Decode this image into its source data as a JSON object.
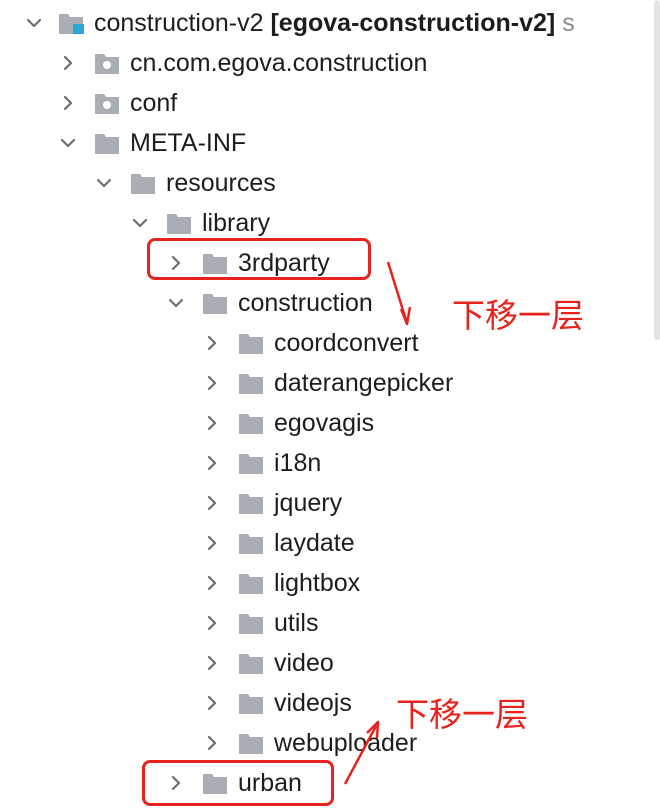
{
  "project": {
    "name": "construction-v2",
    "module_label": "[egova-construction-v2]",
    "trailing": "s"
  },
  "tree": {
    "packages": [
      "cn.com.egova.construction",
      "conf"
    ],
    "meta_inf": "META-INF",
    "resources": "resources",
    "library": "library",
    "library_children": [
      "3rdparty",
      "construction"
    ],
    "construction_children": [
      "coordconvert",
      "daterangepicker",
      "egovagis",
      "i18n",
      "jquery",
      "laydate",
      "lightbox",
      "utils",
      "video",
      "videojs",
      "webuploader"
    ],
    "urban": "urban"
  },
  "annotations": {
    "note_top": "下移一层",
    "note_bottom": "下移一层",
    "highlight_color": "#e8221c"
  },
  "icons": {
    "expanded": "chevron-down-icon",
    "collapsed": "chevron-right-icon",
    "folder": "folder-icon",
    "package": "package-icon",
    "module": "module-icon"
  }
}
